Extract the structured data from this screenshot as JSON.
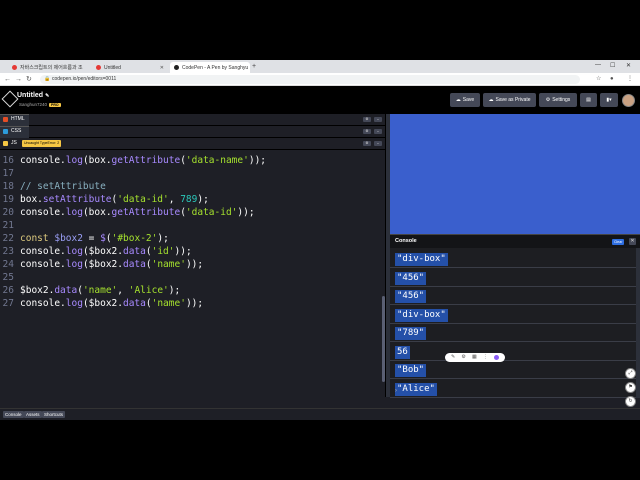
{
  "browser": {
    "tabs": [
      {
        "label": "자바스크립트의 제어흐름과 조",
        "color": "#e53935",
        "active": false
      },
      {
        "label": "Untitled",
        "color": "#e53935",
        "active": false
      },
      {
        "label": "CodePen - A Pen by Sanghyu",
        "color": "#222222",
        "active": true
      }
    ],
    "new_tab": "+",
    "url": "codepen.io/pen/editors=0011"
  },
  "header": {
    "title": "Untitled",
    "title_icon": "pencil-icon",
    "username": "Sanghun7240",
    "pro": "PRO",
    "save_label": "Save",
    "save_private_label": "Save as Private",
    "settings_label": "Settings"
  },
  "panels": {
    "html_label": "HTML",
    "css_label": "CSS",
    "js_label": "JS",
    "js_error": "Uncaught TypeError: 2"
  },
  "code": [
    {
      "n": "16",
      "parts": [
        [
          "",
          "console."
        ],
        [
          "fn",
          "log"
        ],
        [
          "",
          "(box."
        ],
        [
          "fn",
          "getAttribute"
        ],
        [
          "",
          "("
        ],
        [
          "str",
          "'data-name'"
        ],
        [
          "",
          "));"
        ]
      ]
    },
    {
      "n": "17",
      "parts": []
    },
    {
      "n": "18",
      "parts": [
        [
          "cm",
          "// setAttribute"
        ]
      ]
    },
    {
      "n": "19",
      "parts": [
        [
          "",
          "box."
        ],
        [
          "fn",
          "setAttribute"
        ],
        [
          "",
          "("
        ],
        [
          "str",
          "'data-id'"
        ],
        [
          "",
          ", "
        ],
        [
          "num",
          "789"
        ],
        [
          "",
          ");"
        ]
      ]
    },
    {
      "n": "20",
      "parts": [
        [
          "",
          "console."
        ],
        [
          "fn",
          "log"
        ],
        [
          "",
          "(box."
        ],
        [
          "fn",
          "getAttribute"
        ],
        [
          "",
          "("
        ],
        [
          "str",
          "'data-id'"
        ],
        [
          "",
          "));"
        ]
      ]
    },
    {
      "n": "21",
      "parts": []
    },
    {
      "n": "22",
      "parts": [
        [
          "kw",
          "const"
        ],
        [
          "",
          " "
        ],
        [
          "var",
          "$box2"
        ],
        [
          "",
          " = "
        ],
        [
          "fn",
          "$"
        ],
        [
          "",
          "("
        ],
        [
          "str",
          "'#box-2'"
        ],
        [
          "",
          ");"
        ]
      ]
    },
    {
      "n": "23",
      "parts": [
        [
          "",
          "console."
        ],
        [
          "fn",
          "log"
        ],
        [
          "",
          "($box2."
        ],
        [
          "fn",
          "data"
        ],
        [
          "",
          "("
        ],
        [
          "str",
          "'id'"
        ],
        [
          "",
          "));"
        ]
      ]
    },
    {
      "n": "24",
      "parts": [
        [
          "",
          "console."
        ],
        [
          "fn",
          "log"
        ],
        [
          "",
          "($box2."
        ],
        [
          "fn",
          "data"
        ],
        [
          "",
          "("
        ],
        [
          "str",
          "'name'"
        ],
        [
          "",
          "));"
        ]
      ]
    },
    {
      "n": "25",
      "parts": []
    },
    {
      "n": "26",
      "parts": [
        [
          "",
          "$box2."
        ],
        [
          "fn",
          "data"
        ],
        [
          "",
          "("
        ],
        [
          "str",
          "'name'"
        ],
        [
          "",
          ", "
        ],
        [
          "str",
          "'Alice'"
        ],
        [
          "",
          ");"
        ]
      ]
    },
    {
      "n": "27",
      "parts": [
        [
          "",
          "console."
        ],
        [
          "fn",
          "log"
        ],
        [
          "",
          "($box2."
        ],
        [
          "fn",
          "data"
        ],
        [
          "",
          "("
        ],
        [
          "str",
          "'name'"
        ],
        [
          "",
          "));"
        ]
      ]
    }
  ],
  "console": {
    "title": "Console",
    "clear_label": "Clear",
    "entries": [
      "\"div-box\"",
      "\"456\"",
      "\"456\"",
      "\"div-box\"",
      "\"789\"",
      "56",
      "\"Bob\"",
      "\"Alice\""
    ],
    "prompt": "›"
  },
  "bottom": {
    "console_label": "Console",
    "assets_label": "Assets",
    "shortcuts_label": "Shortcuts"
  },
  "colors": {
    "preview_bg": "#3a5fcd",
    "editor_bg": "#1e1f26",
    "console_value_bg": "#2450a8"
  }
}
